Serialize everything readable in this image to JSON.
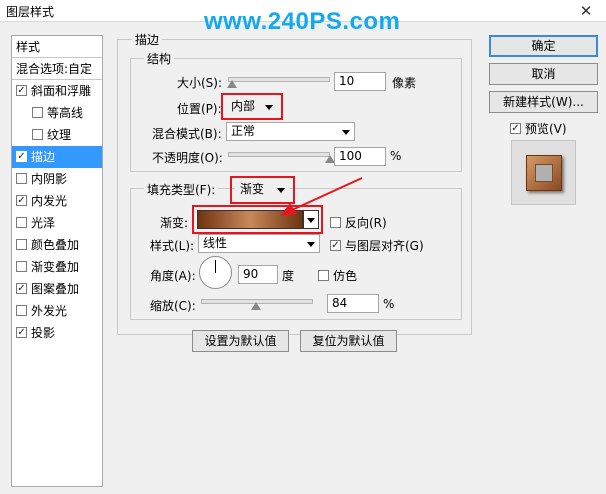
{
  "window": {
    "title": "图层样式",
    "close_glyph": "✕"
  },
  "watermark": "www.240PS.com",
  "left_panel": {
    "header": "样式",
    "blend_options": "混合选项:自定",
    "items": [
      {
        "label": "斜面和浮雕",
        "checked": true,
        "indent": false
      },
      {
        "label": "等高线",
        "checked": false,
        "indent": true
      },
      {
        "label": "纹理",
        "checked": false,
        "indent": true
      },
      {
        "label": "描边",
        "checked": true,
        "indent": false,
        "selected": true
      },
      {
        "label": "内阴影",
        "checked": false,
        "indent": false
      },
      {
        "label": "内发光",
        "checked": true,
        "indent": false
      },
      {
        "label": "光泽",
        "checked": false,
        "indent": false
      },
      {
        "label": "颜色叠加",
        "checked": false,
        "indent": false
      },
      {
        "label": "渐变叠加",
        "checked": false,
        "indent": false
      },
      {
        "label": "图案叠加",
        "checked": true,
        "indent": false
      },
      {
        "label": "外发光",
        "checked": false,
        "indent": false
      },
      {
        "label": "投影",
        "checked": true,
        "indent": false
      }
    ]
  },
  "stroke": {
    "group_title": "描边",
    "structure_title": "结构",
    "size_label": "大小(S):",
    "size_value": "10",
    "size_unit": "像素",
    "size_fraction": 0.04,
    "position_label": "位置(P):",
    "position_value": "内部",
    "blend_label": "混合模式(B):",
    "blend_value": "正常",
    "opacity_label": "不透明度(O):",
    "opacity_value": "100",
    "opacity_unit": "%",
    "opacity_fraction": 1.0
  },
  "fill": {
    "fill_type_label": "填充类型(F):",
    "fill_type_value": "渐变",
    "gradient_label": "渐变:",
    "reverse_label": "反向(R)",
    "reverse_checked": false,
    "style_label": "样式(L):",
    "style_value": "线性",
    "align_label": "与图层对齐(G)",
    "align_checked": true,
    "angle_label": "角度(A):",
    "angle_value": "90",
    "angle_unit": "度",
    "dither_label": "仿色",
    "dither_checked": false,
    "scale_label": "缩放(C):",
    "scale_value": "84",
    "scale_unit": "%",
    "scale_fraction": 0.49
  },
  "bottom_buttons": {
    "set_default": "设置为默认值",
    "reset_default": "复位为默认值"
  },
  "right_panel": {
    "ok": "确定",
    "cancel": "取消",
    "new_style": "新建样式(W)...",
    "preview_label": "预览(V)",
    "preview_checked": true
  },
  "colors": {
    "accent_blue": "#3399ff",
    "highlight_red": "#e8141e",
    "watermark_blue": "#13a9f0",
    "gradient_dark": "#6e3412",
    "gradient_light": "#c8895a"
  }
}
